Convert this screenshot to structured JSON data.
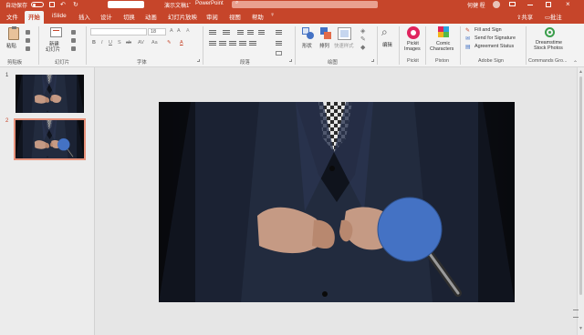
{
  "titlebar": {
    "autosave": "自动保存",
    "toggle": "关",
    "doc_title": "演示文稿1",
    "separator": "-",
    "app": "PowerPoint",
    "user": "何健 程"
  },
  "menu": {
    "items": [
      "文件",
      "开始",
      "iSlide",
      "插入",
      "设计",
      "切换",
      "动画",
      "幻灯片放映",
      "审阅",
      "视图",
      "帮助"
    ],
    "active_index": 1,
    "share": "共享",
    "comments": "批注"
  },
  "ribbon": {
    "paste": "粘贴",
    "clipboard_label": "剪贴板",
    "new_slide": "新建\n幻灯片",
    "new_slide_line1": "新建",
    "new_slide_line2": "幻灯片",
    "slides_label": "幻灯片",
    "font_size": "18",
    "font_label": "字体",
    "paragraph_label": "段落",
    "shape": "形状",
    "arrange": "排列",
    "quick_styles": "快速样式",
    "drawing_label": "绘图",
    "edit": "编辑",
    "pickit_line1": "Pickit",
    "pickit_line2": "Images",
    "pickit_label": "Pickit",
    "comic_line1": "Comic",
    "comic_line2": "Characters",
    "pixton_label": "Pixton",
    "fill_sign": "Fill and Sign",
    "send_signature": "Send for Signature",
    "agreement_status": "Agreement Status",
    "adobe_label": "Adobe Sign",
    "dreamstime_line1": "Dreamstime",
    "dreamstime_line2": "Stock Photos",
    "commands_label": "Commands Gro..."
  },
  "slides_pane": {
    "numbers": [
      "1",
      "2"
    ],
    "selected_index": 1
  },
  "colors": {
    "accent": "#c6452a",
    "magnifier": "#4472c4"
  },
  "icons": [
    "autosave-toggle",
    "save-icon",
    "undo-icon",
    "redo-icon",
    "search-icon",
    "share-icon",
    "comment-icon",
    "paste-icon",
    "new-slide-icon",
    "pickit-icon",
    "comic-icon",
    "adobe-icon",
    "dreamstime-icon"
  ]
}
